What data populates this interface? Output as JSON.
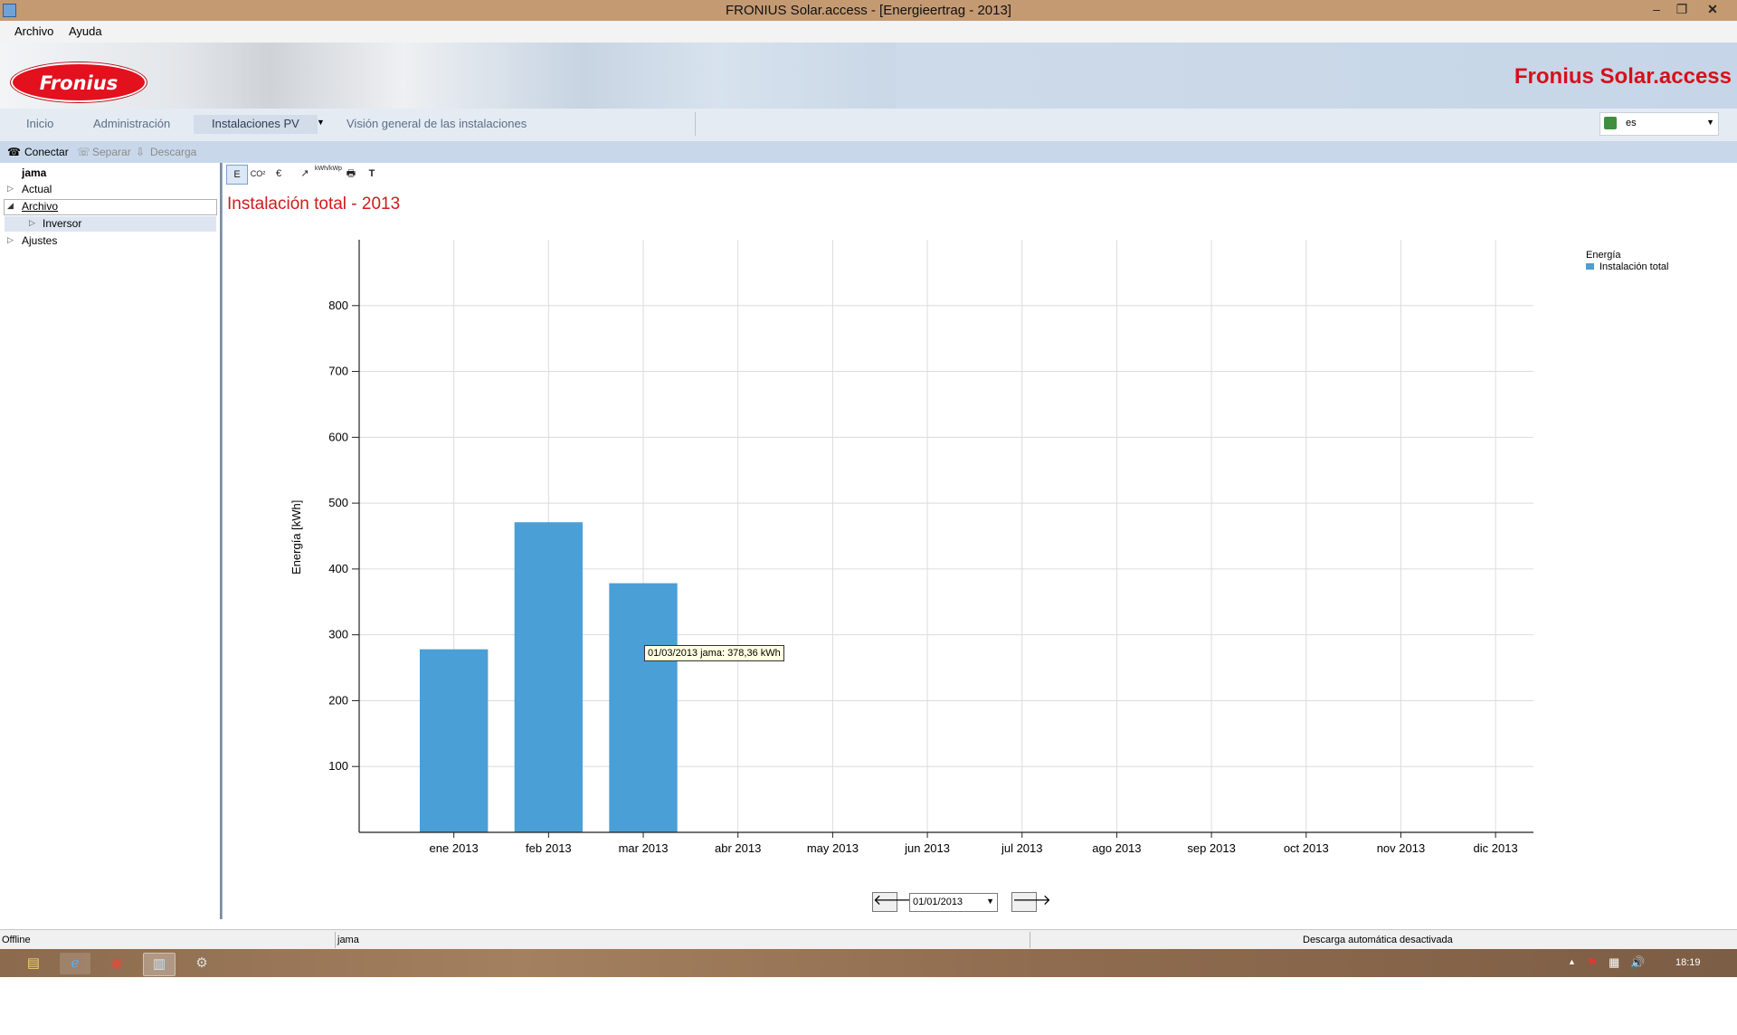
{
  "window": {
    "title": "FRONIUS Solar.access - [Energieertrag - 2013]"
  },
  "menu": {
    "items": [
      "Archivo",
      "Ayuda"
    ]
  },
  "banner": {
    "logo_text": "Fronius",
    "product_title": "Fronius Solar.access"
  },
  "nav": {
    "tabs": [
      "Inicio",
      "Administración",
      "Instalaciones PV",
      "Visión general de las instalaciones"
    ],
    "active_tab": "Instalaciones PV",
    "language_value": "es"
  },
  "toolbar": {
    "connect_label": "Conectar",
    "separate_label": "Separar",
    "download_label": "Descarga"
  },
  "tree": {
    "root_label": "jama",
    "items": [
      {
        "label": "Actual"
      },
      {
        "label": "Archivo"
      },
      {
        "label": "Inversor"
      },
      {
        "label": "Ajustes"
      }
    ]
  },
  "chart_tools": [
    "E",
    "CO²",
    "€",
    "↗",
    "kWh/kWp",
    "print",
    "T"
  ],
  "chart_data": {
    "type": "bar",
    "title": "Instalación total - 2013",
    "ylabel": "Energía [kWh]",
    "xlabel": "",
    "categories": [
      "ene 2013",
      "feb 2013",
      "mar 2013",
      "abr 2013",
      "may 2013",
      "jun 2013",
      "jul 2013",
      "ago 2013",
      "sep 2013",
      "oct 2013",
      "nov 2013",
      "dic 2013"
    ],
    "series": [
      {
        "name": "Instalación total",
        "color": "#4a9fd6",
        "values": [
          278,
          471,
          378.36,
          null,
          null,
          null,
          null,
          null,
          null,
          null,
          null,
          null
        ]
      }
    ],
    "ylim": [
      0,
      900
    ],
    "yticks": [
      100,
      200,
      300,
      400,
      500,
      600,
      700,
      800
    ],
    "grid": true,
    "legend": {
      "title": "Energía",
      "placement": "top-right"
    },
    "tooltip": "01/03/2013 jama: 378,36 kWh"
  },
  "date_nav": {
    "value": "01/01/2013"
  },
  "status": {
    "connection": "Offline",
    "system": "jama",
    "download": "Descarga automática desactivada"
  },
  "taskbar": {
    "clock": "18:19"
  }
}
